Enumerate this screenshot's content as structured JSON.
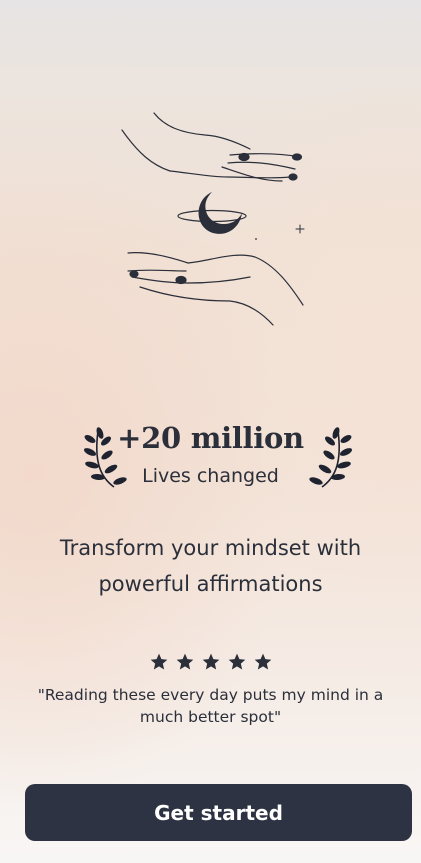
{
  "icons": {
    "illustration": "hands-holding-moon-icon",
    "laurel": "laurel-wreath-icon",
    "star": "star-icon"
  },
  "colors": {
    "primary_dark": "#2d3342",
    "text": "#2b2f3a",
    "button_text": "#ffffff"
  },
  "stat": {
    "number": "+20 million",
    "label": "Lives changed"
  },
  "headline": "Transform your mindset with powerful affirmations",
  "rating": {
    "stars": 5,
    "max": 5
  },
  "quote": "\"Reading these every day puts my mind in a much better spot\"",
  "cta": {
    "label": "Get started"
  }
}
